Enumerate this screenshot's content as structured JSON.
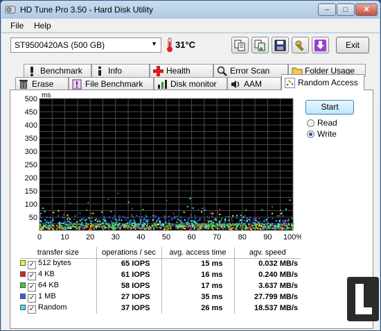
{
  "window": {
    "title": "HD Tune Pro 3.50 - Hard Disk Utility",
    "controls": {
      "minimize": "–",
      "maximize": "□",
      "close": "✕"
    }
  },
  "menu": {
    "file": "File",
    "help": "Help"
  },
  "toolbar": {
    "drive": "ST9500420AS (500 GB)",
    "temperature": "31°C",
    "exit": "Exit"
  },
  "tabs_row1": [
    "Benchmark",
    "Info",
    "Health",
    "Error Scan",
    "Folder Usage"
  ],
  "tabs_row2": [
    "Erase",
    "File Benchmark",
    "Disk monitor",
    "AAM",
    "Random Access"
  ],
  "active_tab": "Random Access",
  "controls": {
    "start": "Start",
    "read": "Read",
    "write": "Write",
    "selected_mode": "Write"
  },
  "chart_data": {
    "type": "scatter",
    "ylabel": "ms",
    "ylim": [
      0,
      500
    ],
    "y_ticks": [
      "500",
      "450",
      "400",
      "350",
      "300",
      "250",
      "200",
      "150",
      "100",
      "50"
    ],
    "x_ticks": [
      "0",
      "10",
      "20",
      "30",
      "40",
      "50",
      "60",
      "70",
      "80",
      "90",
      "100%"
    ],
    "xlim": [
      0,
      100
    ],
    "background": "#000000",
    "grid": true,
    "series": [
      {
        "name": "512 bytes",
        "color": "#f5f52a",
        "approx_access_ms": 15
      },
      {
        "name": "4 KB",
        "color": "#e02020",
        "approx_access_ms": 16
      },
      {
        "name": "64 KB",
        "color": "#2fcf2f",
        "approx_access_ms": 17
      },
      {
        "name": "1 MB",
        "color": "#2f5fe8",
        "approx_access_ms": 35
      },
      {
        "name": "Random",
        "color": "#3fe0e0",
        "approx_access_ms": 26
      }
    ]
  },
  "table": {
    "headers": [
      "transfer size",
      "operations / sec",
      "avg. access time",
      "agv. speed"
    ],
    "rows": [
      {
        "size": "512 bytes",
        "color": "#f5f52a",
        "ops": "65 IOPS",
        "access": "15 ms",
        "speed": "0.032 MB/s"
      },
      {
        "size": "4 KB",
        "color": "#e02020",
        "ops": "61 IOPS",
        "access": "16 ms",
        "speed": "0.240 MB/s"
      },
      {
        "size": "64 KB",
        "color": "#2fcf2f",
        "ops": "58 IOPS",
        "access": "17 ms",
        "speed": "3.637 MB/s"
      },
      {
        "size": "1 MB",
        "color": "#2f5fe8",
        "ops": "27 IOPS",
        "access": "35 ms",
        "speed": "27.799 MB/s"
      },
      {
        "size": "Random",
        "color": "#3fe0e0",
        "ops": "37 IOPS",
        "access": "26 ms",
        "speed": "18.537 MB/s"
      }
    ]
  }
}
